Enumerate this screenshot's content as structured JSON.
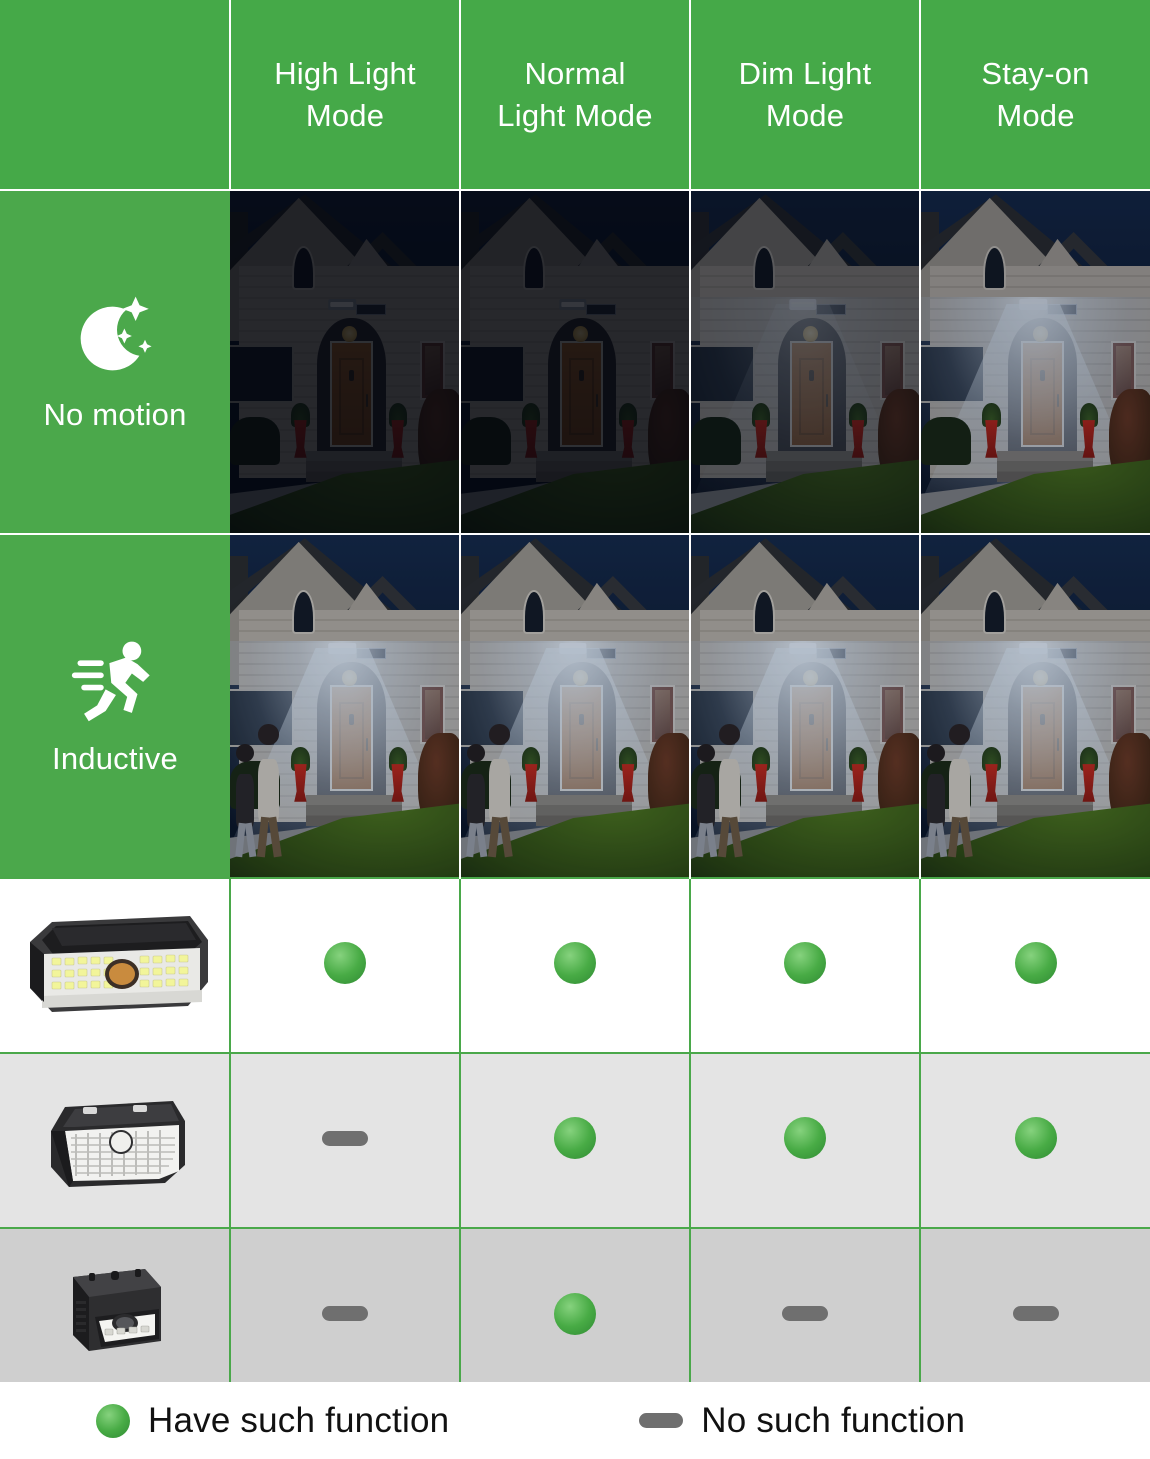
{
  "table": {
    "header": {
      "corner_label": "",
      "modes": [
        {
          "label": "High Light\nMode",
          "key": "high"
        },
        {
          "label": "Normal\nLight Mode",
          "key": "normal"
        },
        {
          "label": "Dim Light\nMode",
          "key": "dim"
        },
        {
          "label": "Stay-on\nMode",
          "key": "stayon"
        }
      ]
    },
    "scenario_rows": [
      {
        "label": "No motion",
        "icon": "moon-stars-icon",
        "cells": [
          {
            "mode": "high",
            "state": "off",
            "caption": "Dark house facade at night, light fixture off"
          },
          {
            "mode": "normal",
            "state": "off",
            "caption": "Dark house facade at night, light fixture off"
          },
          {
            "mode": "dim",
            "state": "dim",
            "caption": "House facade at night, fixture glowing dimly above door"
          },
          {
            "mode": "stayon",
            "state": "on",
            "caption": "House facade at night, fixture on lighting doorway and walkway"
          }
        ]
      },
      {
        "label": "Inductive",
        "icon": "running-person-icon",
        "cells": [
          {
            "mode": "high",
            "state": "high",
            "caption": "Two people approaching, fixture at full brightness"
          },
          {
            "mode": "normal",
            "state": "high",
            "caption": "Two people approaching, fixture at full brightness"
          },
          {
            "mode": "dim",
            "state": "high",
            "caption": "Two people approaching, fixture at full brightness"
          },
          {
            "mode": "stayon",
            "state": "high",
            "caption": "Two people approaching, fixture at full brightness"
          }
        ]
      }
    ],
    "product_rows": [
      {
        "product": "wide-solar-led-wall-light",
        "shade": "white",
        "support": [
          "yes",
          "yes",
          "yes",
          "yes"
        ]
      },
      {
        "product": "compact-solar-led-flood-light",
        "shade": "gray-light",
        "support": [
          "no",
          "yes",
          "yes",
          "yes"
        ]
      },
      {
        "product": "small-solar-motion-sensor-light",
        "shade": "gray-dark",
        "support": [
          "no",
          "yes",
          "no",
          "no"
        ]
      }
    ]
  },
  "legend": {
    "have": {
      "marker": "green-dot",
      "text": "Have such function"
    },
    "none": {
      "marker": "gray-dash",
      "text": "No such function"
    }
  },
  "colors": {
    "header_green": "#45a948",
    "label_green": "#4ba84b",
    "grid_green": "#4aa84a",
    "marker_green": "#3d9e3f",
    "marker_gray": "#6f6f6f",
    "row_white": "#ffffff",
    "row_gray_light": "#e4e4e4",
    "row_gray_dark": "#cfcfcf"
  }
}
